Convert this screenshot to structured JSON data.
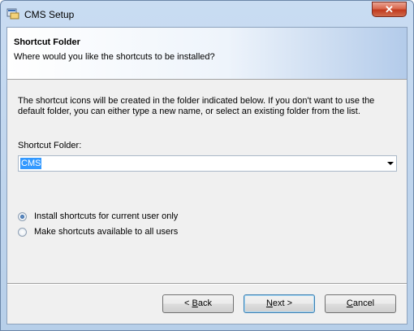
{
  "window": {
    "title": "CMS Setup",
    "close_glyph": "✕"
  },
  "header": {
    "title": "Shortcut Folder",
    "subtitle": "Where would you like the shortcuts to be installed?"
  },
  "description": "The shortcut icons will be created in the folder indicated below. If you don't want to use the default folder, you can either type a new name, or select an existing folder from the list.",
  "shortcut_folder": {
    "label": "Shortcut Folder:",
    "value": "CMS"
  },
  "options": [
    {
      "label": "Install shortcuts for current user only",
      "checked": true
    },
    {
      "label": "Make shortcuts available to all users",
      "checked": false
    }
  ],
  "buttons": {
    "back": {
      "mnemonic": "B",
      "rest": "ack",
      "prefix": "< "
    },
    "next": {
      "mnemonic": "N",
      "rest": "ext >"
    },
    "cancel": {
      "mnemonic": "C",
      "rest": "ancel"
    }
  },
  "colors": {
    "selection": "#3399ff",
    "close_button": "#c13a1e"
  },
  "icons": {
    "app": "installer-icon",
    "close": "close-icon",
    "dropdown": "chevron-down-icon"
  }
}
